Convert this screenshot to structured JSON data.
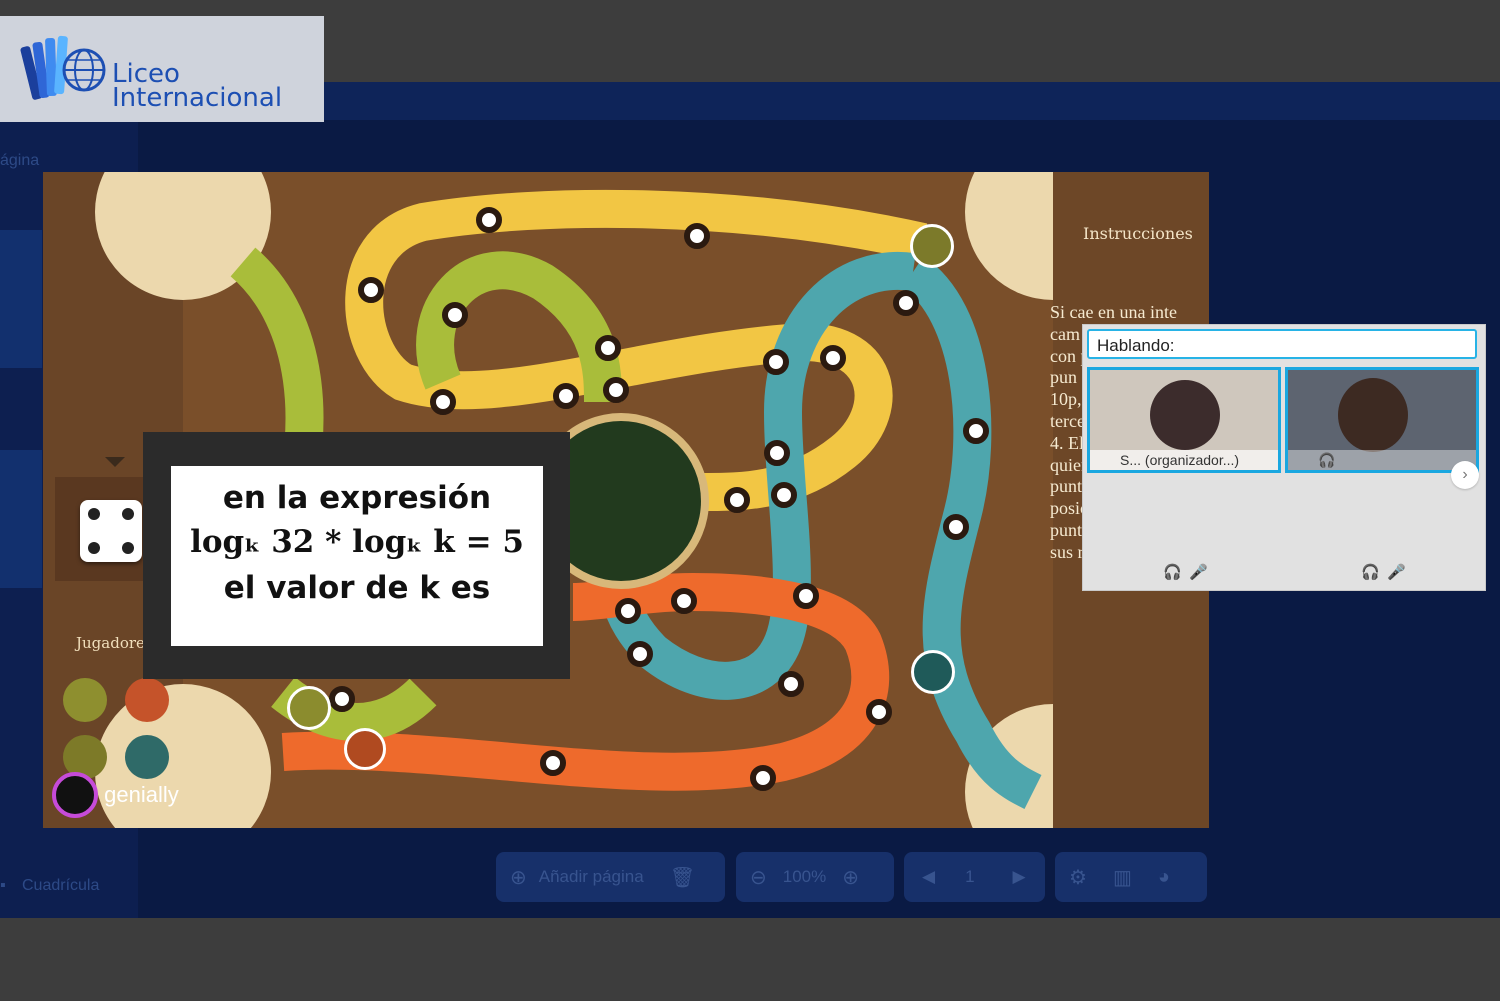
{
  "logo": {
    "line1": "Liceo",
    "line2": "Internacional"
  },
  "editor": {
    "page_hint": "ágina",
    "grid_label": "Cuadrícula",
    "toolbar": {
      "add_page": "Añadir página",
      "zoom": "100%",
      "page_number": "1"
    }
  },
  "game": {
    "instructions_title": "Instrucciones",
    "instructions_text": "Si cae en una inte cam retr casi Si s con preg un p acie pun El p lleg tiene 10p, el segundo 8, el tercero 6 y el último 4. El ganador será quien tenga el mayor puntaje según su posición y los puntos obtenidos en sus respuestas.",
    "players_label": "Jugadore",
    "question": {
      "line1": "en la expresión",
      "line2": "logₖ 32 * logₖ k = 5",
      "line3": "el valor de k es"
    },
    "brand": "genially"
  },
  "meeting": {
    "speaking_label": "Hablando:",
    "participants": [
      {
        "name": "S...",
        "role": "(organizador...)"
      },
      {
        "name": "",
        "role": ""
      }
    ]
  },
  "colors": {
    "board_brown": "#6b4423",
    "yellow_path": "#f2c644",
    "green_path": "#a9bd3a",
    "teal_path": "#4ea6ad",
    "orange_path": "#ee6a2c",
    "editor_bg": "#0a1a44",
    "accent_blue": "#1aa7e0"
  }
}
